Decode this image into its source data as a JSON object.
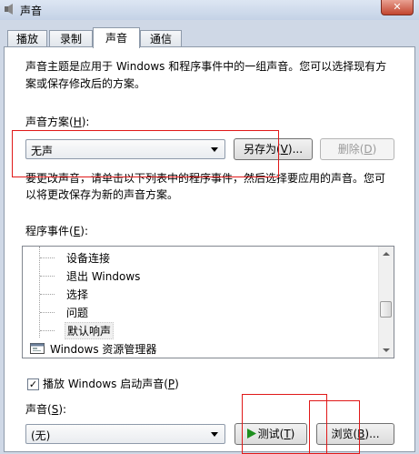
{
  "window": {
    "title": "声音",
    "close_glyph": "✕"
  },
  "tabs": [
    {
      "label": "播放"
    },
    {
      "label": "录制"
    },
    {
      "label": "声音",
      "active": true
    },
    {
      "label": "通信"
    }
  ],
  "description": {
    "line1": "声音主题是应用于 Windows 和程序事件中的一组声音。您可以选择现有方",
    "line2": "案或保存修改后的方案。"
  },
  "scheme": {
    "label": "声音方案(",
    "label_key": "H",
    "label_end": "):",
    "selected": "无声",
    "save_as": "另存为(",
    "save_as_key": "V",
    "save_as_end": ")...",
    "delete": "删除(",
    "delete_key": "D",
    "delete_end": ")"
  },
  "instructions": {
    "line1": "要更改声音，请单击以下列表中的程序事件，然后选择要应用的声音。您可",
    "line2": "以将更改保存为新的声音方案。"
  },
  "events": {
    "label": "程序事件(",
    "label_key": "E",
    "label_end": "):",
    "items": [
      "设备连接",
      "退出 Windows",
      "选择",
      "问题",
      "默认响声"
    ],
    "group": "Windows 资源管理器",
    "selected_index": 4
  },
  "startup_sound": {
    "checked": true,
    "check_glyph": "✓",
    "label": "播放 Windows 启动声音(",
    "label_key": "P",
    "label_end": ")"
  },
  "sound": {
    "label": "声音(",
    "label_key": "S",
    "label_end": "):",
    "selected": "(无)",
    "test": "测试(",
    "test_key": "T",
    "test_end": ")",
    "browse": "浏览(",
    "browse_key": "B",
    "browse_end": ")..."
  },
  "colors": {
    "highlight_box": "#e01818",
    "play_icon": "#1e8f1e"
  }
}
